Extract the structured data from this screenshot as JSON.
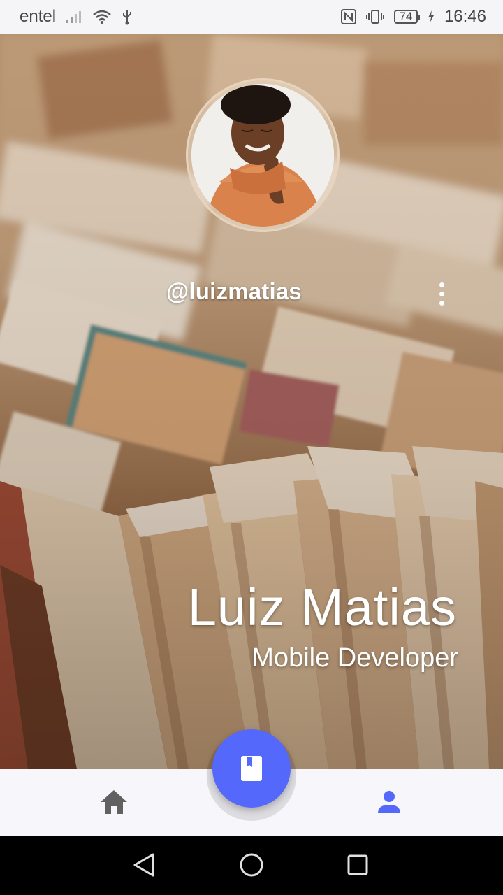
{
  "status_bar": {
    "carrier": "entel",
    "battery": "74",
    "time": "16:46"
  },
  "profile": {
    "username": "@luizmatias",
    "name": "Luiz Matias",
    "role": "Mobile Developer"
  },
  "icons": {
    "more": "more-vert-icon",
    "home": "home-icon",
    "profile": "person-icon",
    "fab": "book-icon"
  },
  "colors": {
    "accent": "#5469fb",
    "nav_active": "#5469fb",
    "nav_inactive": "#616161"
  }
}
